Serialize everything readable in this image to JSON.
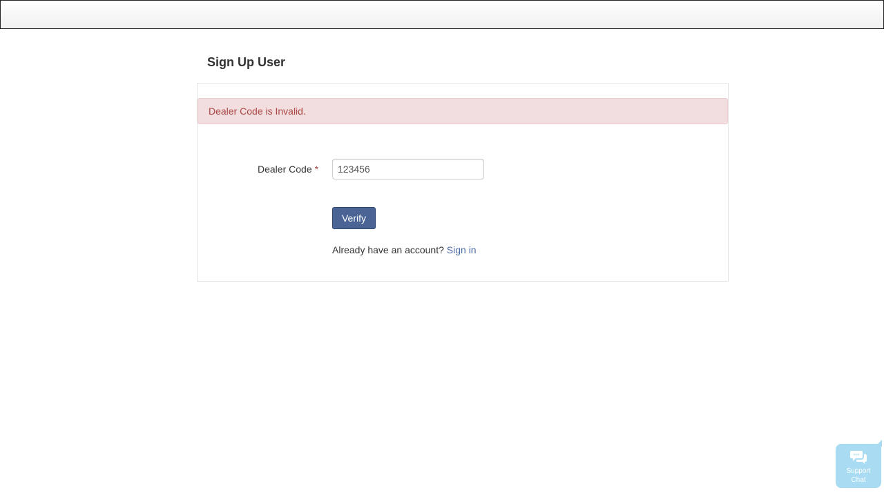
{
  "page": {
    "title": "Sign Up User"
  },
  "alert": {
    "message": "Dealer Code is Invalid."
  },
  "form": {
    "dealer_code_label": "Dealer Code",
    "required_marker": "*",
    "dealer_code_value": "123456",
    "verify_label": "Verify"
  },
  "signin": {
    "prompt": "Already have an account?",
    "link_label": "Sign in"
  },
  "support_chat": {
    "label_line1": "Support",
    "label_line2": "Chat",
    "icon": "chat-bubbles-icon"
  },
  "colors": {
    "alert_bg": "#f2dede",
    "alert_text": "#a94442",
    "button_bg": "#4a6595",
    "link": "#4a6aa5",
    "chat_bg": "#a9dcf2"
  }
}
